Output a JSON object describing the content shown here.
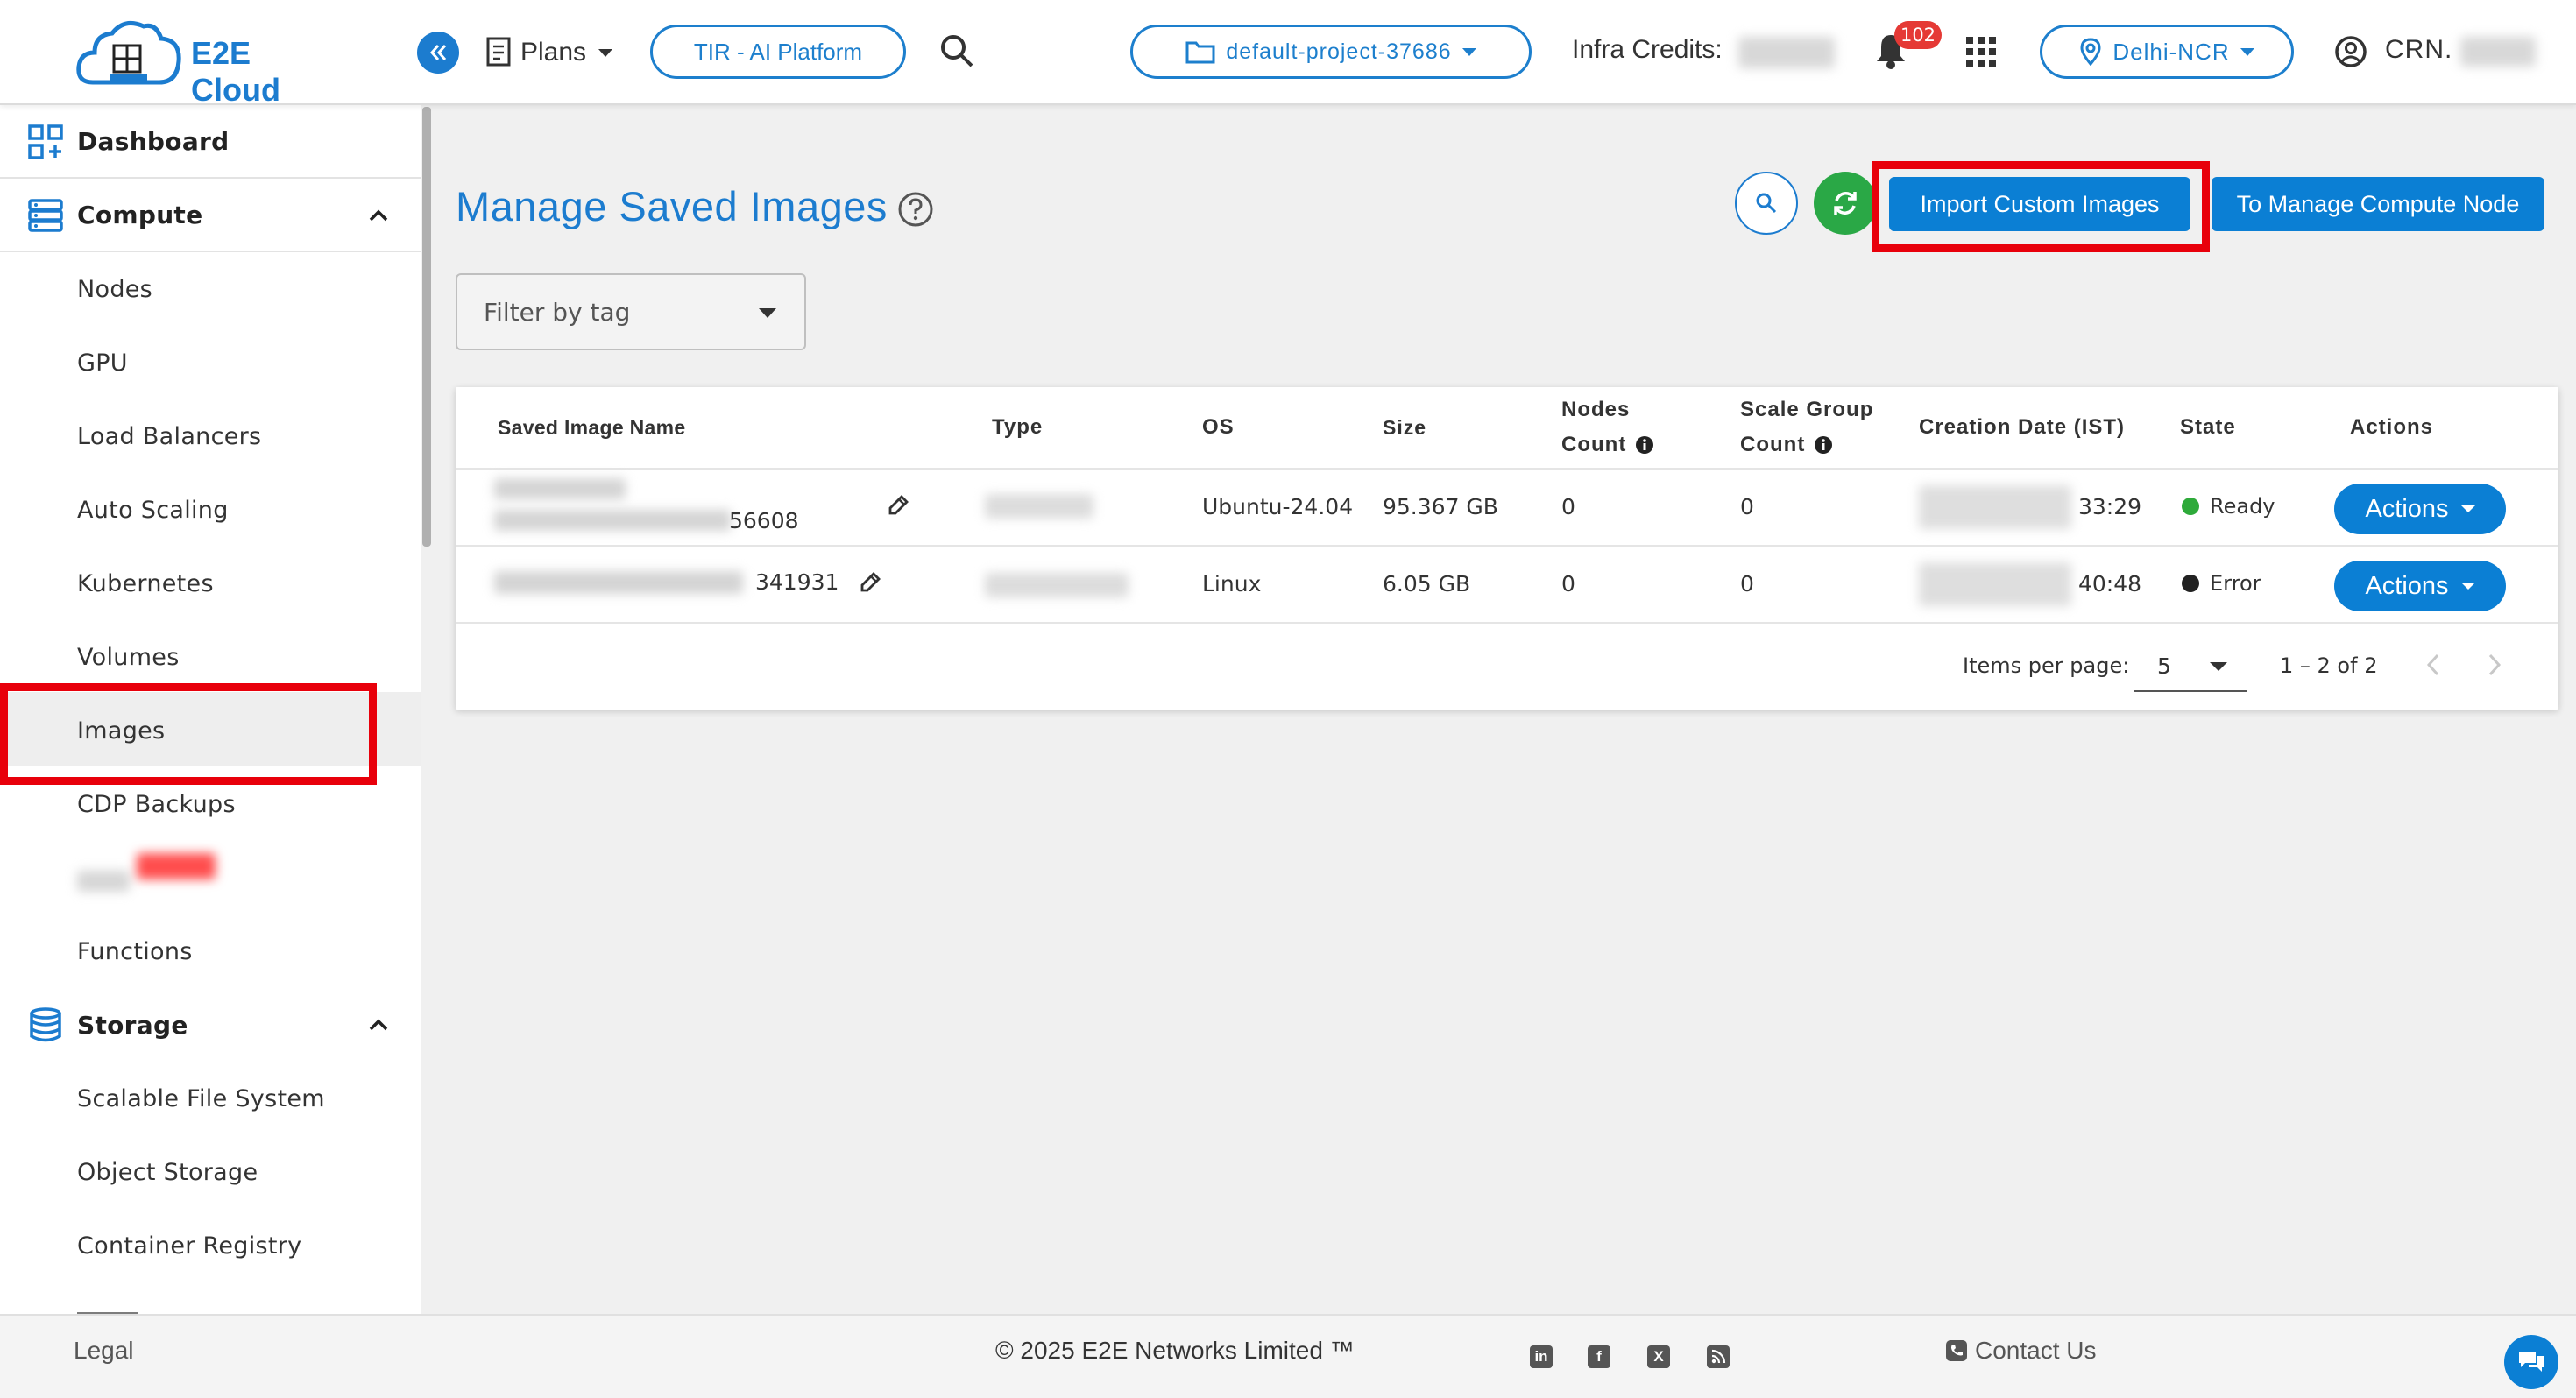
{
  "header": {
    "brand": "E2E Cloud",
    "plans_label": "Plans",
    "platform_button": "TIR - AI Platform",
    "project": "default-project-37686",
    "infra_credits_label": "Infra Credits:",
    "notification_count": "102",
    "region": "Delhi-NCR",
    "account_label": "CRN."
  },
  "sidebar": {
    "dashboard": "Dashboard",
    "compute": {
      "label": "Compute",
      "items": [
        "Nodes",
        "GPU",
        "Load Balancers",
        "Auto Scaling",
        "Kubernetes",
        "Volumes",
        "Images",
        "CDP Backups",
        "",
        "Functions"
      ]
    },
    "storage": {
      "label": "Storage",
      "items": [
        "Scalable File System",
        "Object Storage",
        "Container Registry"
      ]
    },
    "active_item": "Images"
  },
  "main": {
    "title": "Manage Saved Images",
    "import_button": "Import Custom Images",
    "compute_node_button": "To Manage Compute Node",
    "filter_placeholder": "Filter by tag"
  },
  "table": {
    "headers": {
      "name": "Saved Image Name",
      "type": "Type",
      "os": "OS",
      "size": "Size",
      "nodes_count_1": "Nodes",
      "nodes_count_2": "Count",
      "scale_group_1": "Scale Group",
      "scale_group_2": "Count",
      "creation_date": "Creation Date (IST)",
      "state": "State",
      "actions": "Actions"
    },
    "rows": [
      {
        "name_suffix": "56608",
        "os": "Ubuntu-24.04",
        "size": "95.367 GB",
        "nodes_count": "0",
        "scale_group_count": "0",
        "time_suffix": "33:29",
        "state": "Ready",
        "action_label": "Actions"
      },
      {
        "name_suffix": "341931",
        "os": "Linux",
        "size": "6.05 GB",
        "nodes_count": "0",
        "scale_group_count": "0",
        "time_suffix": "40:48",
        "state": "Error",
        "action_label": "Actions"
      }
    ],
    "paginator": {
      "items_per_page_label": "Items per page:",
      "page_size": "5",
      "range": "1 – 2 of 2"
    }
  },
  "footer": {
    "legal": "Legal",
    "copyright": "© 2025 E2E Networks Limited ™",
    "contact": "Contact Us"
  },
  "colors": {
    "accent": "#1c7ccf",
    "button": "#0b7fd4",
    "highlight": "#e8000b",
    "ready": "#2eaa3a",
    "error": "#222222",
    "refresh": "#2aa846",
    "badge": "#e53935"
  }
}
